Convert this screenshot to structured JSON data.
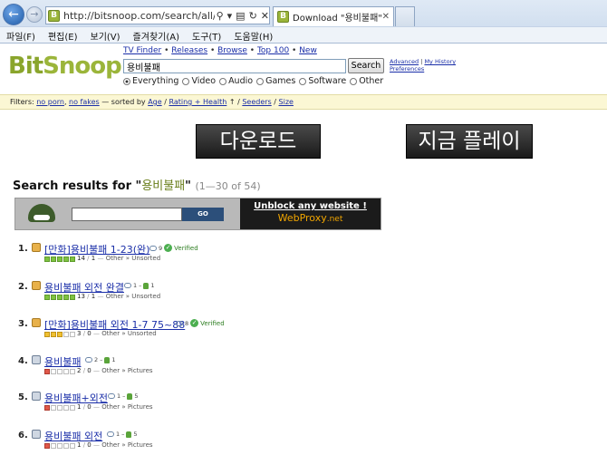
{
  "browser": {
    "url": "http://bitsnoop.com/search/all/%EC%9A%A9%E",
    "tab_title": "Download \"용비불패\" torre...",
    "menu": [
      "파일(F)",
      "편집(E)",
      "보기(V)",
      "즐겨찾기(A)",
      "도구(T)",
      "도움말(H)"
    ]
  },
  "site": {
    "logo_bit": "Bit",
    "logo_snoop": "Snoop",
    "top_links": [
      "TV Finder",
      "Releases",
      "Browse",
      "Top 100",
      "New"
    ],
    "search_value": "용비불패",
    "search_button": "Search",
    "advanced": "Advanced",
    "my_history": "My History",
    "preferences": "Preferences",
    "categories": [
      "Everything",
      "Video",
      "Audio",
      "Games",
      "Software",
      "Other"
    ],
    "selected_category": "Everything"
  },
  "filters": {
    "label": "Filters:",
    "no_porn": "no porn",
    "no_fakes": "no fakes",
    "sorted_by": "— sorted by",
    "age": "Age",
    "rating_health": "Rating + Health",
    "arrow": "↑",
    "seeders": "Seeders",
    "size": "Size"
  },
  "buttons": {
    "download": "다운로드",
    "play_now": "지금 플레이"
  },
  "results": {
    "prefix": "Search results for \"",
    "query": "용비불패",
    "suffix": "\"",
    "count": "(1—30 of 54)"
  },
  "ad": {
    "go": "GO",
    "line1": "Unblock any website !",
    "line2": "WebProxy",
    "line2_tld": ".net"
  },
  "rows": [
    {
      "num": "1.",
      "title": "[만화]용비불패 1-23(완)",
      "icon": "box",
      "comments": "9",
      "thumbs": "",
      "verified": "Verified",
      "health": "ggggg",
      "seeds": "14",
      "leech": "1",
      "cat": "Other » Unsorted"
    },
    {
      "num": "2.",
      "title": "용비불패 외전 완결",
      "icon": "box",
      "comments": "1",
      "thumbs": "1",
      "verified": "",
      "health": "ggggg",
      "seeds": "13",
      "leech": "1",
      "cat": "Other » Unsorted"
    },
    {
      "num": "3.",
      "title": "[만화]용비불패 외전 1-7 75~88",
      "icon": "box",
      "comments": "8",
      "thumbs": "",
      "verified": "Verified",
      "health": "yyyee",
      "seeds": "3",
      "leech": "0",
      "cat": "Other » Unsorted"
    },
    {
      "num": "4.",
      "title": "용비불패",
      "icon": "pic",
      "comments": "2",
      "thumbs": "1",
      "verified": "",
      "health": "reeee",
      "seeds": "2",
      "leech": "0",
      "cat": "Other » Pictures"
    },
    {
      "num": "5.",
      "title": "용비불패+외전",
      "icon": "pic",
      "comments": "1",
      "thumbs": "5",
      "verified": "",
      "health": "reeee",
      "seeds": "1",
      "leech": "0",
      "cat": "Other » Pictures"
    },
    {
      "num": "6.",
      "title": "용비불패 외전",
      "icon": "pic",
      "comments": "1",
      "thumbs": "5",
      "verified": "",
      "health": "reeee",
      "seeds": "1",
      "leech": "0",
      "cat": "Other » Pictures"
    }
  ]
}
